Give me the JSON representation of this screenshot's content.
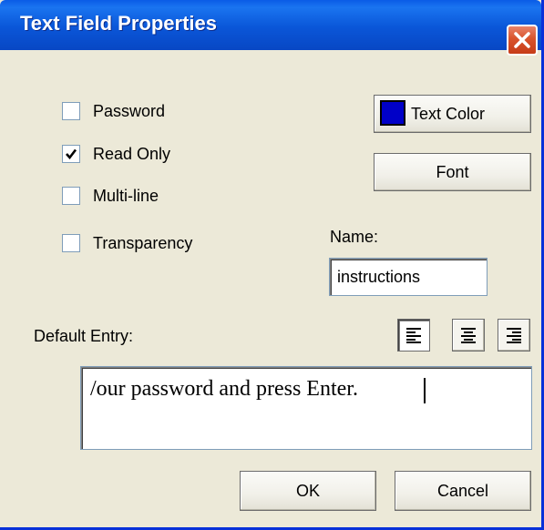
{
  "window": {
    "title": "Text Field Properties"
  },
  "options": {
    "password": {
      "label": "Password",
      "checked": false
    },
    "read_only": {
      "label": "Read Only",
      "checked": true
    },
    "multi_line": {
      "label": "Multi-line",
      "checked": false
    },
    "transparency": {
      "label": "Transparency",
      "checked": false
    }
  },
  "text_color": {
    "label": "Text Color",
    "swatch_color": "#0000c8"
  },
  "font": {
    "label": "Font"
  },
  "name": {
    "label": "Name:",
    "value": "instructions"
  },
  "default_entry": {
    "label": "Default Entry:",
    "value": "your password and press Enter.",
    "visible_value": "/our password and press Enter.",
    "alignment": "left"
  },
  "footer": {
    "ok_label": "OK",
    "cancel_label": "Cancel"
  },
  "colors": {
    "titlebar": "#0a5ce6",
    "dialog_bg": "#ece9d8",
    "close_button": "#d9532c"
  },
  "icons": [
    "close-icon",
    "checkmark-icon",
    "align-left-icon",
    "align-center-icon",
    "align-right-icon"
  ]
}
